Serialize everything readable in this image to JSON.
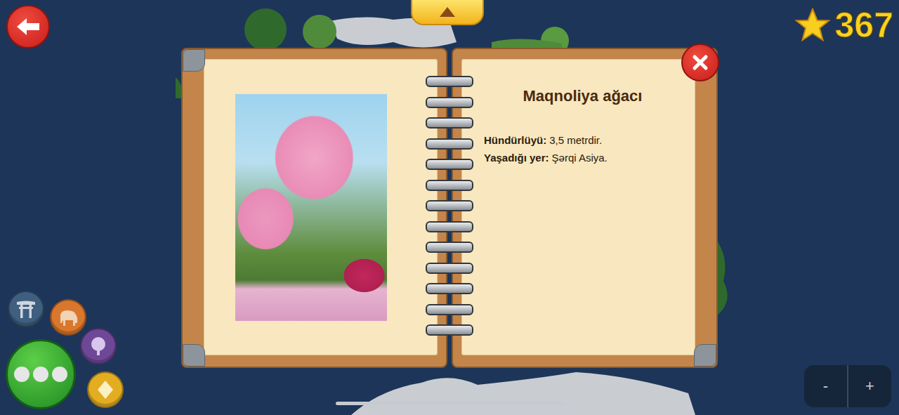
{
  "score": "367",
  "book": {
    "title": "Maqnoliya ağacı",
    "facts": [
      {
        "label": "Hündürlüyü:",
        "value": "3,5 metrdir."
      },
      {
        "label": "Yaşadığı yer:",
        "value": "Şərqi Asiya."
      }
    ]
  },
  "categories": [
    {
      "kind": "torii",
      "color": "#3e5f80",
      "selected": false
    },
    {
      "kind": "elephant",
      "color": "#d9772c",
      "selected": false
    },
    {
      "kind": "tree",
      "color": "#6e4896",
      "selected": false
    },
    {
      "kind": "diamond",
      "color": "#e3ad22",
      "selected": false
    }
  ],
  "zoom": {
    "minus": "-",
    "plus": "+"
  }
}
